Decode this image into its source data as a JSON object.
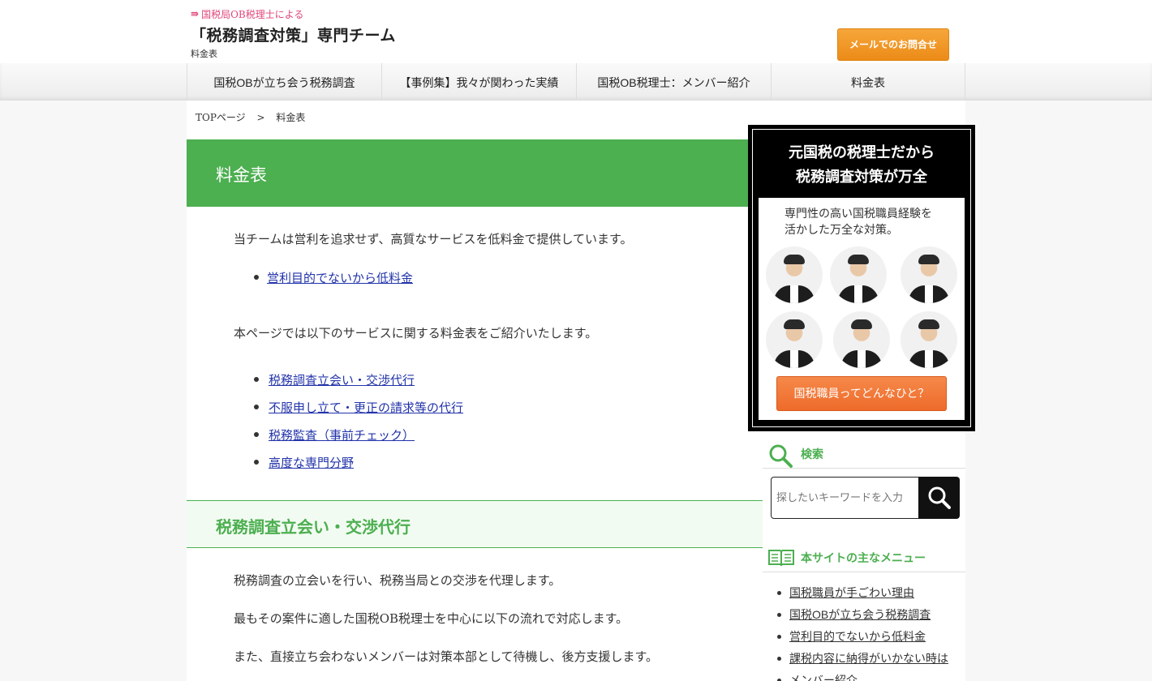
{
  "header": {
    "tagline": "国税局OB税理士による",
    "title": "「税務調査対策」専門チーム",
    "subtitle": "料金表",
    "contact_button": "メールでのお問合せ"
  },
  "nav": {
    "items": [
      {
        "label": "国税OBが立ち会う税務調査"
      },
      {
        "label": "【事例集】我々が関わった実績"
      },
      {
        "label": "国税OB税理士：メンバー紹介"
      },
      {
        "label": "料金表"
      }
    ]
  },
  "breadcrumb": {
    "home": "TOPページ",
    "separator": ">",
    "current": "料金表"
  },
  "main": {
    "page_title": "料金表",
    "intro": "当チームは営利を追求せず、高質なサービスを低料金で提供しています。",
    "intro_link": "営利目的でないから低料金",
    "services_intro": "本ページでは以下のサービスに関する料金表をご紹介いたします。",
    "service_links": [
      "税務調査立会い・交渉代行",
      "不服申し立て・更正の請求等の代行",
      "税務監査（事前チェック）",
      "高度な専門分野"
    ],
    "section_title": "税務調査立会い・交渉代行",
    "section_paragraphs": [
      "税務調査の立会いを行い、税務当局との交渉を代理します。",
      "最もその案件に適した国税OB税理士を中心に以下の流れで対応します。",
      "また、直接立ち会わないメンバーは対策本部として待機し、後方支援します。"
    ]
  },
  "sidebar": {
    "banner": {
      "title_line1": "元国税の税理士だから",
      "title_line2": "税務調査対策が万全",
      "desc_line1": "専門性の高い国税職員経験を",
      "desc_line2": "活かした万全な対策。",
      "button": "国税職員ってどんなひと？"
    },
    "search": {
      "heading": "検索",
      "placeholder": "探したいキーワードを入力"
    },
    "menu": {
      "heading": "本サイトの主なメニュー",
      "items": [
        "国税職員が手ごわい理由",
        "国税OBが立ち会う税務調査",
        "営利目的でないから低料金",
        "課税内容に納得がいかない時は",
        "メンバー紹介"
      ]
    }
  },
  "colors": {
    "accent_green": "#4caf50",
    "contact_orange": "#ec8b18",
    "banner_button_orange": "#ee6b2a",
    "link_blue": "#2233aa"
  }
}
